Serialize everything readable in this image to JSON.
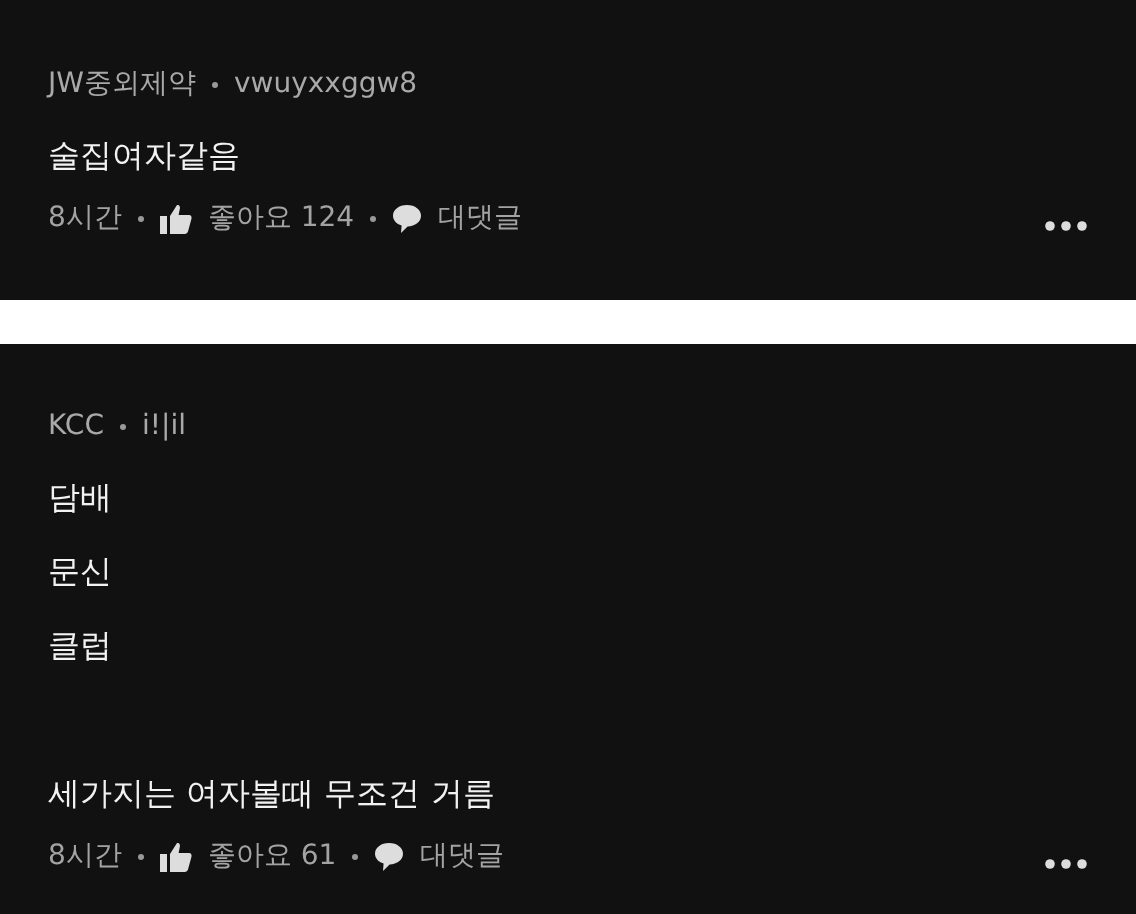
{
  "comments": [
    {
      "company": "JW중외제약",
      "nickname": "vwuyxxggw8",
      "paragraphs": [
        [
          "술집여자같음"
        ]
      ],
      "time": "8시간",
      "likes_label": "좋아요",
      "likes": "124",
      "reply_label": "대댓글"
    },
    {
      "company": "KCC",
      "nickname": "i!|il",
      "paragraphs": [
        [
          "담배",
          "문신",
          "클럽"
        ],
        [
          "세가지는 여자볼때 무조건 거름"
        ]
      ],
      "time": "8시간",
      "likes_label": "좋아요",
      "likes": "61",
      "reply_label": "대댓글"
    }
  ]
}
